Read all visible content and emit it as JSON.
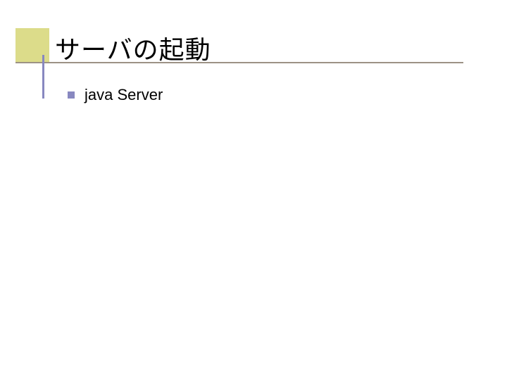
{
  "slide": {
    "title": "サーバの起動",
    "bullets": [
      {
        "text": "java Server"
      }
    ]
  },
  "colors": {
    "title_square": "#dcdc8a",
    "title_underline": "#9c9285",
    "title_vline": "#8888c0",
    "bullet": "#8888c0"
  }
}
